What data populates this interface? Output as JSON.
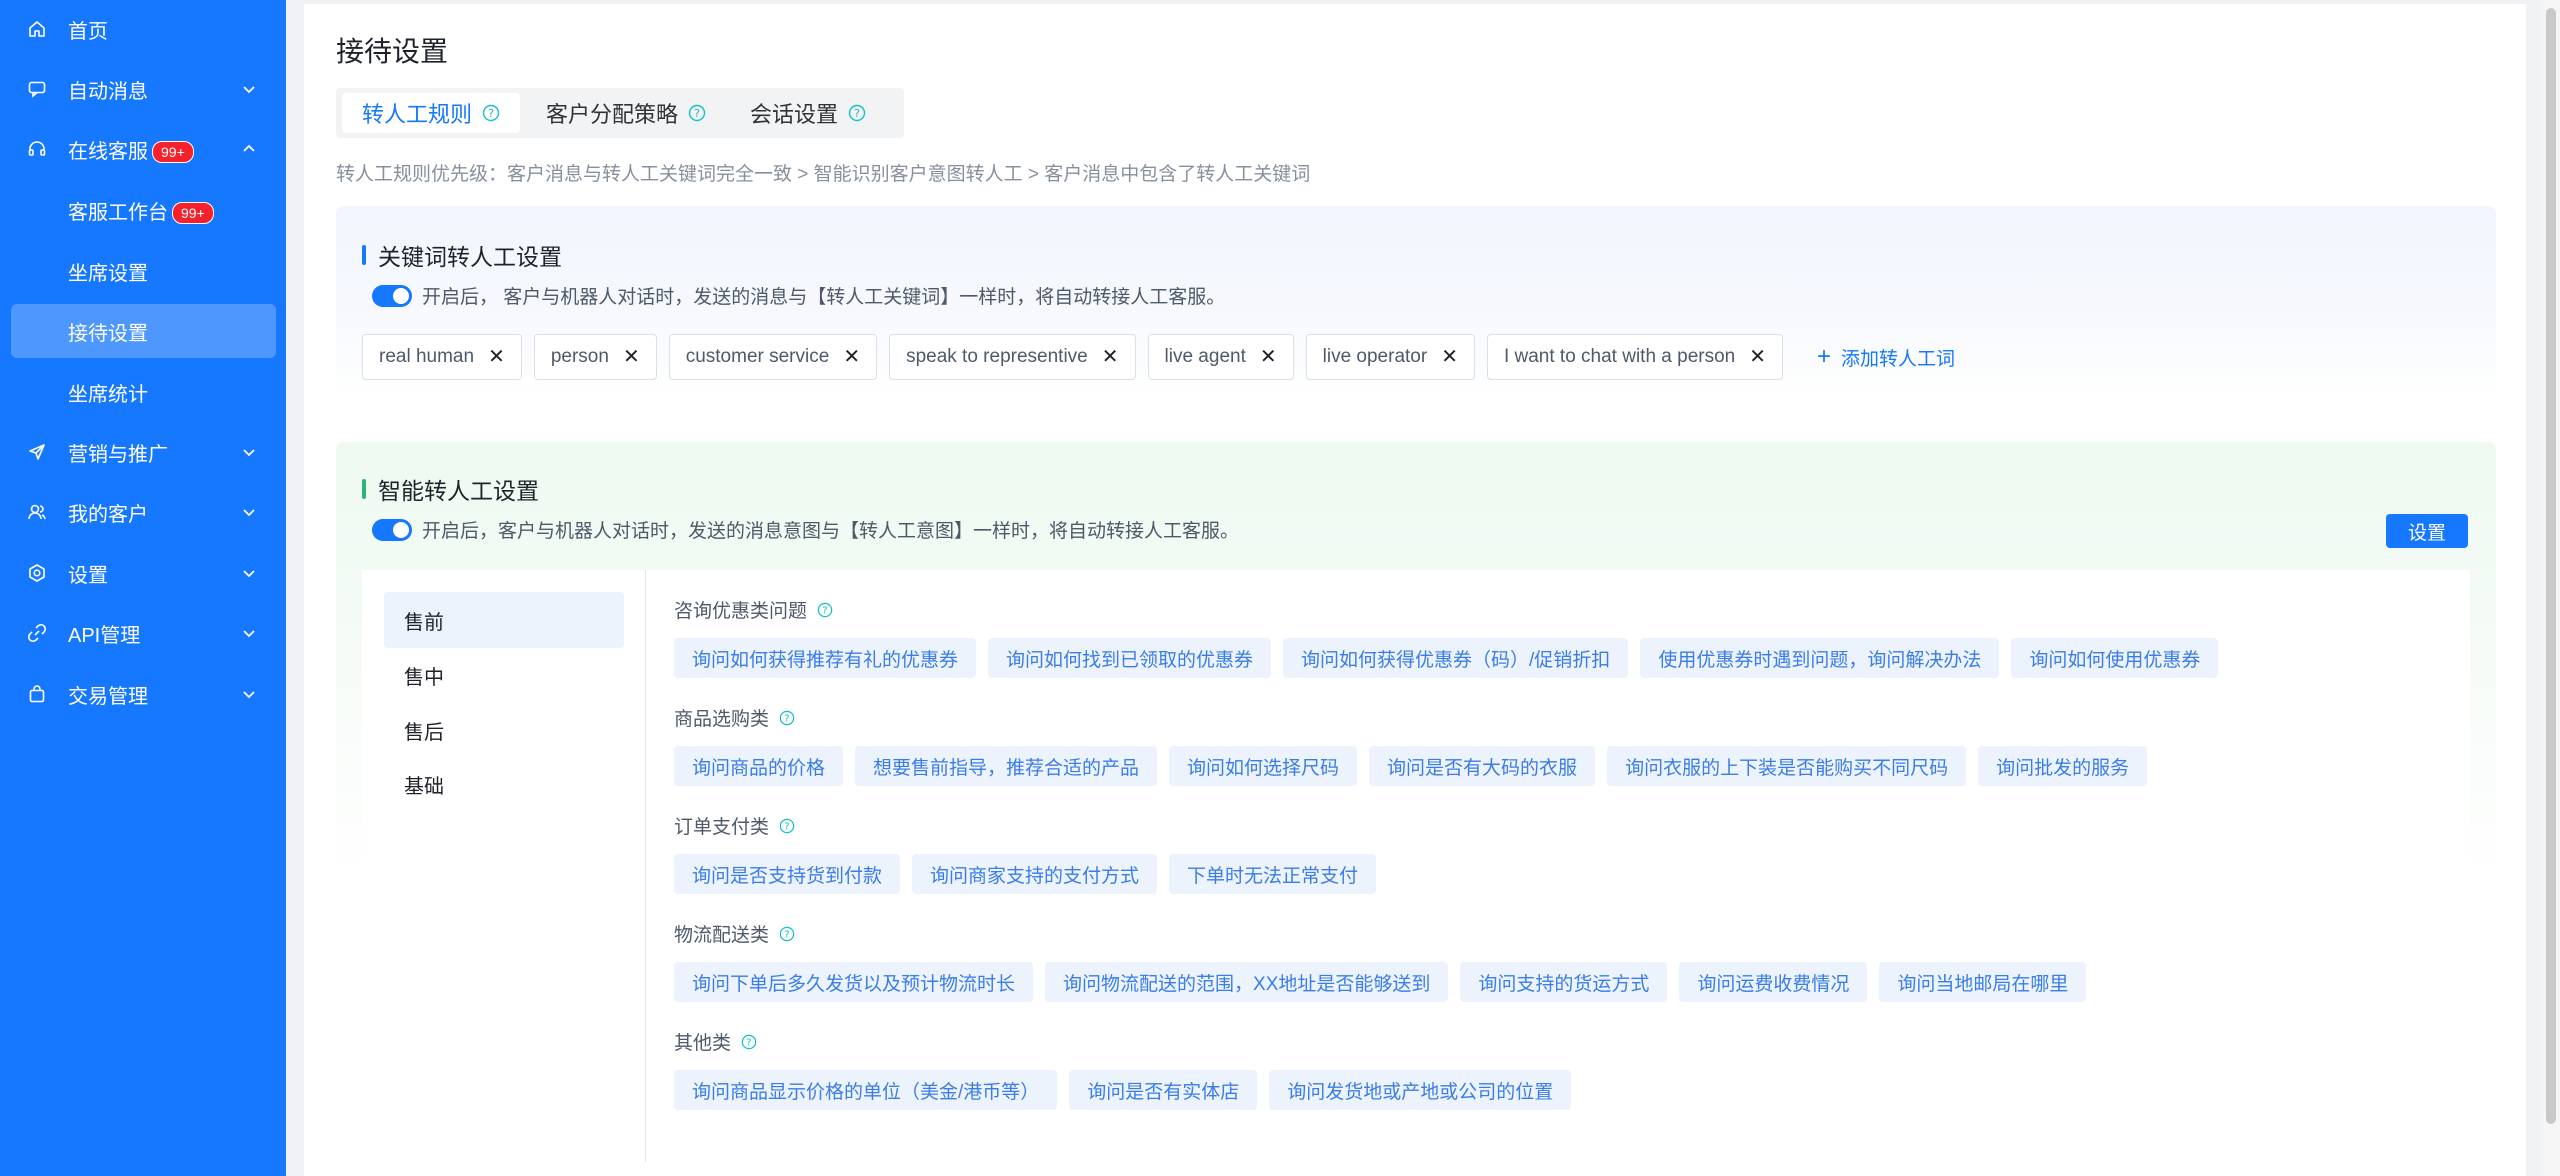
{
  "sidebar": {
    "items": [
      {
        "label": "首页",
        "icon": "home-icon"
      },
      {
        "label": "自动消息",
        "icon": "message-icon"
      },
      {
        "label": "在线客服",
        "icon": "headset-icon",
        "badge": "99+"
      },
      {
        "label": "客服工作台",
        "badge": "99+"
      },
      {
        "label": "坐席设置"
      },
      {
        "label": "接待设置"
      },
      {
        "label": "坐席统计"
      },
      {
        "label": "营销与推广",
        "icon": "send-icon"
      },
      {
        "label": "我的客户",
        "icon": "users-icon"
      },
      {
        "label": "设置",
        "icon": "settings-icon"
      },
      {
        "label": "API管理",
        "icon": "link-icon"
      },
      {
        "label": "交易管理",
        "icon": "bag-icon"
      }
    ]
  },
  "page": {
    "title": "接待设置",
    "tabs": [
      "转人工规则",
      "客户分配策略",
      "会话设置"
    ],
    "priority_text": "转人工规则优先级：客户消息与转人工关键词完全一致 > 智能识别客户意图转人工 > 客户消息中包含了转人工关键词"
  },
  "keyword_section": {
    "title": "关键词转人工设置",
    "switch_text": "开启后， 客户与机器人对话时，发送的消息与【转人工关键词】一样时，将自动转接人工客服。",
    "keywords": [
      "real human",
      "person",
      "customer service",
      "speak to representive",
      "live agent",
      "live operator",
      "I want to chat with a person"
    ],
    "add_label": "添加转人工词",
    "close_glyph": "✕",
    "plus_glyph": "+"
  },
  "intent_section": {
    "title": "智能转人工设置",
    "switch_text": "开启后，客户与机器人对话时，发送的消息意图与【转人工意图】一样时，将自动转接人工客服。",
    "set_button": "设置",
    "stages": [
      "售前",
      "售中",
      "售后",
      "基础"
    ],
    "categories": [
      {
        "name": "咨询优惠类问题",
        "intents": [
          "询问如何获得推荐有礼的优惠券",
          "询问如何找到已领取的优惠券",
          "询问如何获得优惠券（码）/促销折扣",
          "使用优惠券时遇到问题，询问解决办法",
          "询问如何使用优惠券"
        ]
      },
      {
        "name": "商品选购类",
        "intents": [
          "询问商品的价格",
          "想要售前指导，推荐合适的产品",
          "询问如何选择尺码",
          "询问是否有大码的衣服",
          "询问衣服的上下装是否能购买不同尺码",
          "询问批发的服务"
        ]
      },
      {
        "name": "订单支付类",
        "intents": [
          "询问是否支持货到付款",
          "询问商家支持的支付方式",
          "下单时无法正常支付"
        ]
      },
      {
        "name": "物流配送类",
        "intents": [
          "询问下单后多久发货以及预计物流时长",
          "询问物流配送的范围，XX地址是否能够送到",
          "询问支持的货运方式",
          "询问运费收费情况",
          "询问当地邮局在哪里"
        ]
      },
      {
        "name": "其他类",
        "intents": [
          "询问商品显示价格的单位（美金/港币等）",
          "询问是否有实体店",
          "询问发货地或产地或公司的位置"
        ]
      }
    ]
  },
  "colors": {
    "primary": "#1677ff",
    "sidebar": "#1677ff",
    "badge": "#f5222d",
    "green_bar": "#2bb673"
  }
}
